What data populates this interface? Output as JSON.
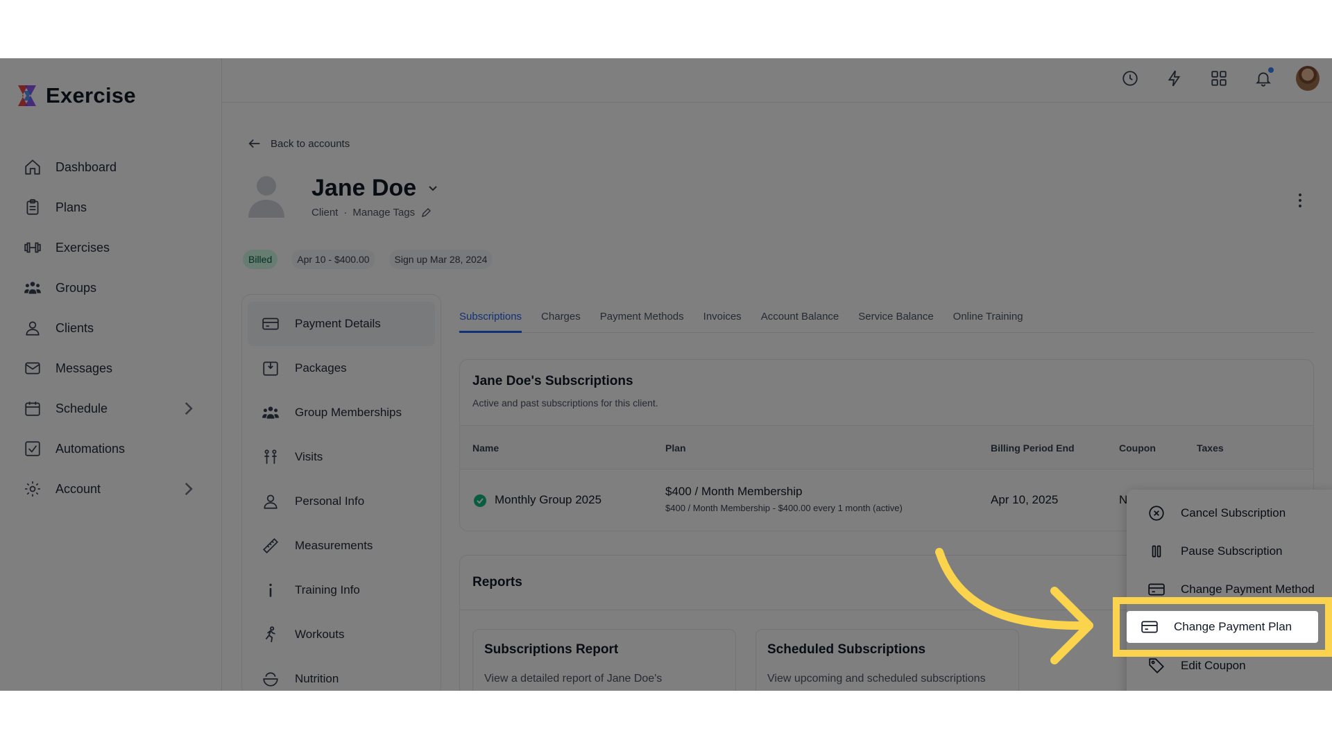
{
  "app": {
    "name": "Exercise"
  },
  "sidebar": {
    "items": [
      {
        "label": "Dashboard",
        "icon": "home-icon"
      },
      {
        "label": "Plans",
        "icon": "clipboard-icon"
      },
      {
        "label": "Exercises",
        "icon": "dumbbell-icon"
      },
      {
        "label": "Groups",
        "icon": "group-icon"
      },
      {
        "label": "Clients",
        "icon": "user-icon"
      },
      {
        "label": "Messages",
        "icon": "mail-icon"
      },
      {
        "label": "Schedule",
        "icon": "calendar-icon",
        "has_chevron": true
      },
      {
        "label": "Automations",
        "icon": "checkbox-icon"
      },
      {
        "label": "Account",
        "icon": "gear-icon",
        "has_chevron": true
      }
    ]
  },
  "topbar": {
    "icons": [
      "clock-icon",
      "bolt-icon",
      "grid-icon",
      "bell-icon",
      "user-avatar"
    ]
  },
  "header": {
    "back_label": "Back to accounts",
    "client_name": "Jane Doe",
    "client_role": "Client",
    "separator": "·",
    "manage_tags": "Manage Tags"
  },
  "badges": {
    "billed": "Billed",
    "next": "Apr 10 - $400.00",
    "signup": "Sign up Mar 28, 2024"
  },
  "panel": {
    "items": [
      {
        "label": "Payment Details",
        "icon": "credit-card-icon"
      },
      {
        "label": "Packages",
        "icon": "package-icon"
      },
      {
        "label": "Group Memberships",
        "icon": "group-icon"
      },
      {
        "label": "Visits",
        "icon": "visits-icon"
      },
      {
        "label": "Personal Info",
        "icon": "user-icon"
      },
      {
        "label": "Measurements",
        "icon": "ruler-icon"
      },
      {
        "label": "Training Info",
        "icon": "info-icon"
      },
      {
        "label": "Workouts",
        "icon": "running-icon"
      },
      {
        "label": "Nutrition",
        "icon": "bowl-icon"
      }
    ]
  },
  "tabs": [
    "Subscriptions",
    "Charges",
    "Payment Methods",
    "Invoices",
    "Account Balance",
    "Service Balance",
    "Online Training"
  ],
  "subscriptions": {
    "title": "Jane Doe's Subscriptions",
    "subtitle": "Active and past subscriptions for this client.",
    "columns": [
      "Name",
      "Plan",
      "Billing Period End",
      "Coupon",
      "Taxes"
    ],
    "row": {
      "name": "Monthly Group 2025",
      "plan": "$400 / Month Membership",
      "plan_detail": "$400 / Month Membership - $400.00 every 1 month (active)",
      "billing_end": "Apr 10, 2025",
      "coupon": "N"
    }
  },
  "reports": {
    "title": "Reports",
    "cards": [
      {
        "title": "Subscriptions Report",
        "desc": "View a detailed report of Jane Doe's"
      },
      {
        "title": "Scheduled Subscriptions",
        "desc": "View upcoming and scheduled subscriptions"
      }
    ]
  },
  "menu": {
    "items": [
      "Cancel Subscription",
      "Pause Subscription",
      "Change Payment Method",
      "Change Payment Plan",
      "Edit Coupon"
    ],
    "highlighted": "Change Payment Plan"
  },
  "colors": {
    "accent": "#2563eb",
    "highlight": "#fcd34d",
    "success": "#10b981"
  }
}
